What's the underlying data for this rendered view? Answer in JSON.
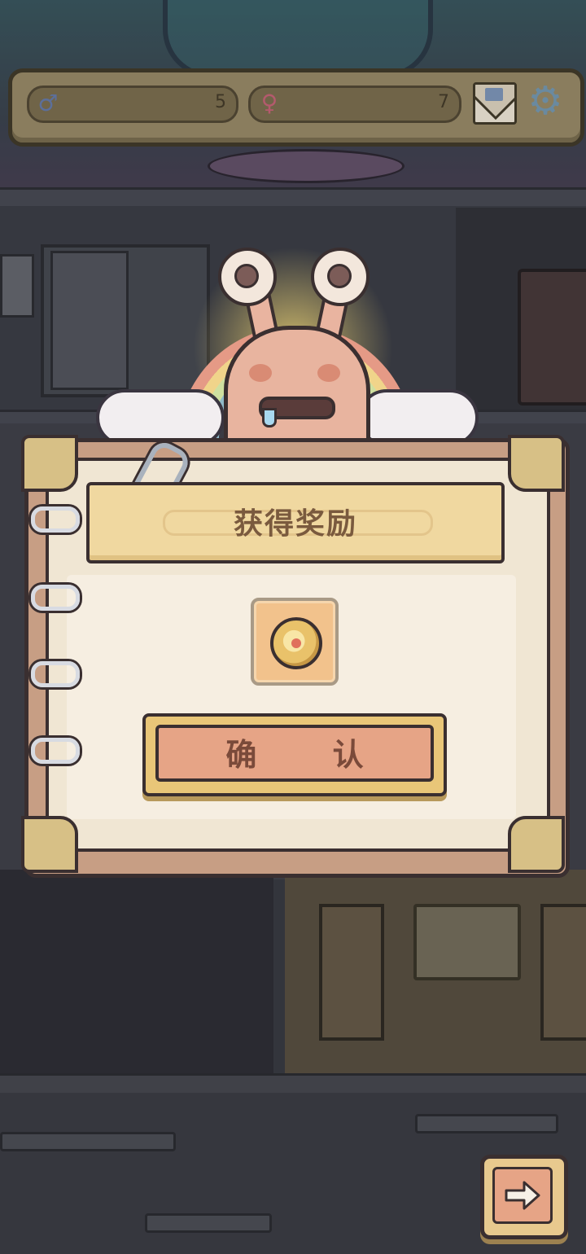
{
  "hud": {
    "male_icon": "male-symbol-icon",
    "male_count": "5",
    "female_icon": "female-symbol-icon",
    "female_count": "7",
    "mail_icon": "mail-icon",
    "settings_icon": "gear-icon"
  },
  "dialog": {
    "title": "获得奖励",
    "reward_item_icon": "coin-reward-icon",
    "confirm_label": "确 认"
  },
  "navigation": {
    "next_icon": "right-arrow-icon"
  },
  "colors": {
    "hud_bg": "#8a7d5e",
    "dialog_page": "#f0e6d3",
    "title_banner": "#f0d8a0",
    "confirm_button": "#e6a486",
    "title_text": "#7a5a3e"
  }
}
